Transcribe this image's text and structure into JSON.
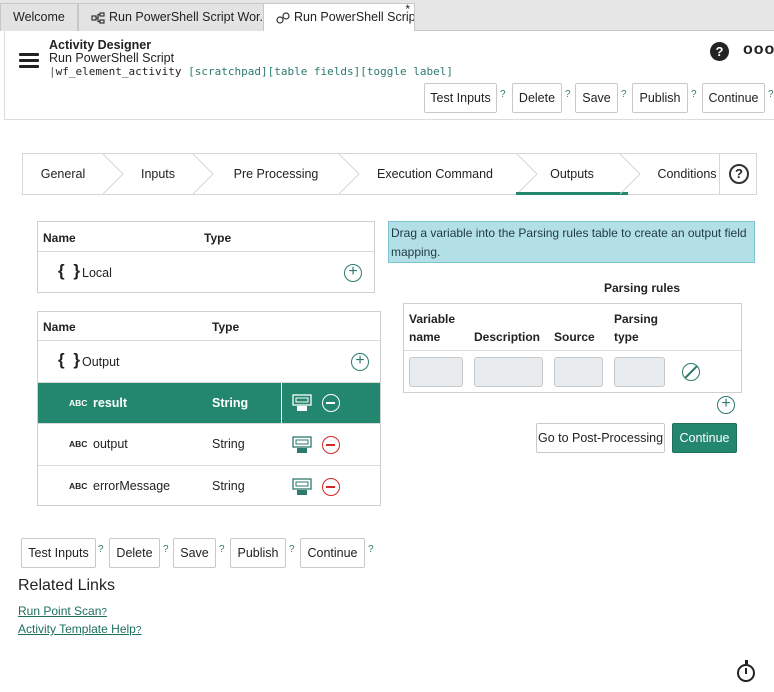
{
  "tabs": [
    {
      "label": "Welcome"
    },
    {
      "label": "Run PowerShell Script Wor..."
    },
    {
      "label": "Run PowerShell Script",
      "dirty": "*"
    }
  ],
  "header": {
    "title": "Activity Designer",
    "subtitle": "Run PowerShell Script",
    "path_bar": "|",
    "path_table": "wf_element_activity",
    "path_links": [
      "[scratchpad]",
      "[table fields]",
      "[toggle label]"
    ],
    "help": "?",
    "more": "ooo"
  },
  "actions": {
    "test_inputs": "Test Inputs",
    "delete": "Delete",
    "save": "Save",
    "publish": "Publish",
    "continue": "Continue",
    "q": "?"
  },
  "steps": [
    "General",
    "Inputs",
    "Pre Processing",
    "Execution Command",
    "Outputs",
    "Conditions"
  ],
  "step_help": "?",
  "local_table": {
    "col_name": "Name",
    "col_type": "Type",
    "local_label": "Local",
    "braces": "{ }"
  },
  "output_table": {
    "col_name": "Name",
    "col_type": "Type",
    "output_label": "Output",
    "braces": "{ }",
    "abc": "ABC",
    "rows": [
      {
        "name": "result",
        "type": "String"
      },
      {
        "name": "output",
        "type": "String"
      },
      {
        "name": "errorMessage",
        "type": "String"
      }
    ]
  },
  "info_text": "Drag a variable into the Parsing rules table to create an output field mapping.",
  "parsing": {
    "title": "Parsing rules",
    "col_var_1": "Variable",
    "col_var_2": "name",
    "col_desc": "Description",
    "col_source": "Source",
    "col_ptype_1": "Parsing",
    "col_ptype_2": "type"
  },
  "go_post": "Go to Post-Processing",
  "continue_label": "Continue",
  "related": {
    "title": "Related Links",
    "links": [
      "Run Point Scan",
      "Activity Template Help"
    ],
    "q": "?"
  },
  "plus": "+",
  "colors": {
    "accent": "#23876f",
    "danger": "#d02a2a",
    "info_bg": "#b3e0e7"
  }
}
